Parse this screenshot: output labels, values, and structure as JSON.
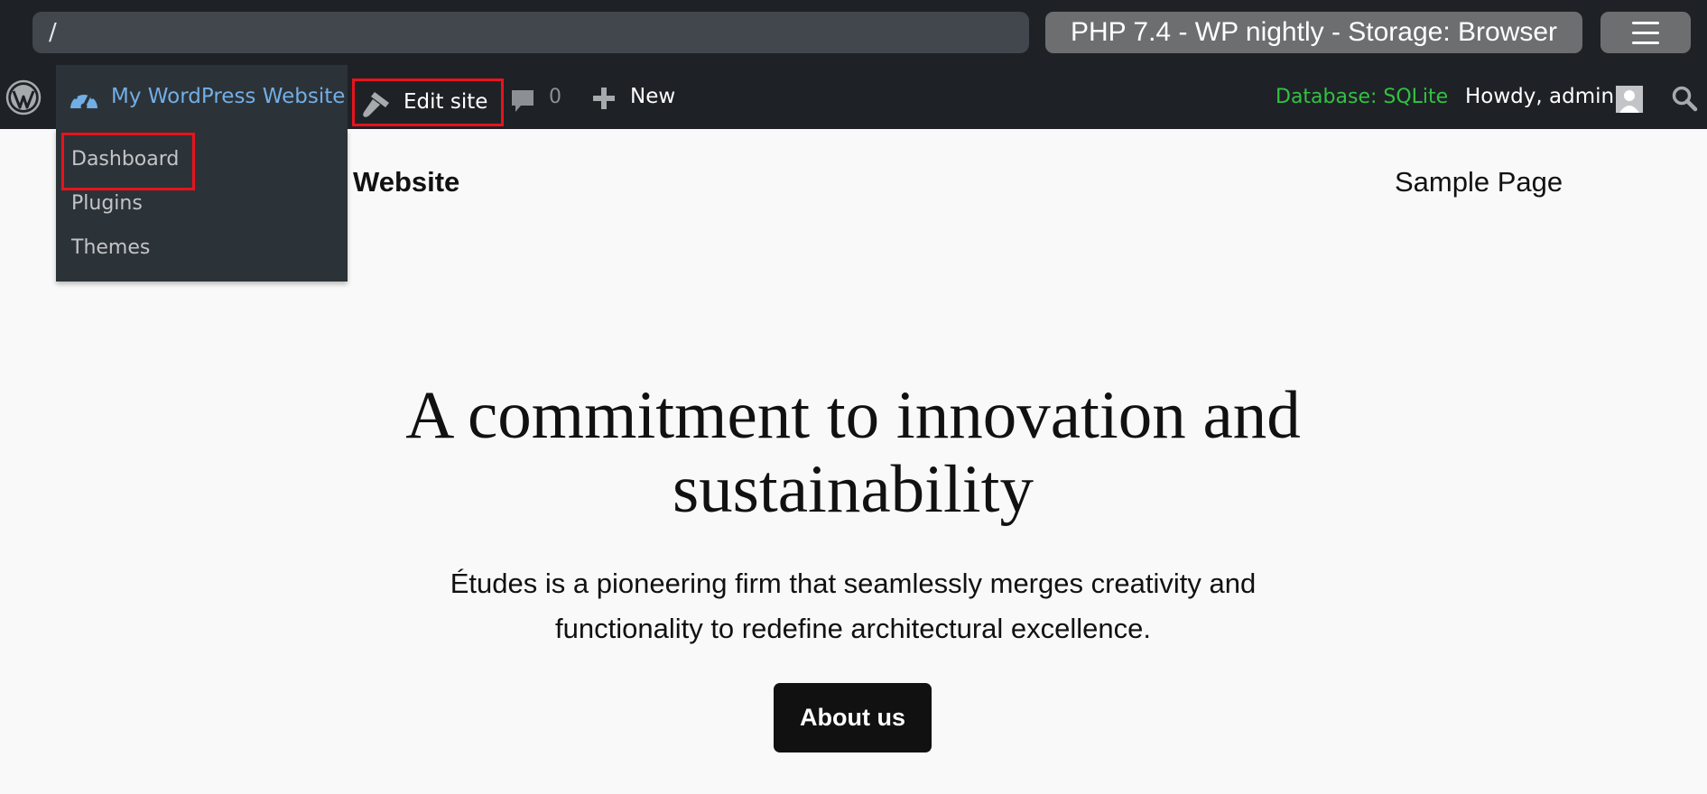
{
  "browser": {
    "url": "/",
    "environment_label": "PHP 7.4 - WP nightly - Storage: Browser",
    "menu_icon": "hamburger-menu-icon"
  },
  "admin_bar": {
    "wp_logo_icon": "wordpress-logo-icon",
    "site_icon": "dashboard-gauge-icon",
    "site_name": "My WordPress Website",
    "edit_site_icon": "paintbrush-icon",
    "edit_site_label": "Edit site",
    "comments_icon": "comment-bubble-icon",
    "comment_count": "0",
    "new_icon": "plus-icon",
    "new_label": "New",
    "database_label": "Database: SQLite",
    "howdy_label": "Howdy, admin",
    "search_icon": "search-icon"
  },
  "site_dropdown": {
    "items": [
      {
        "label": "Dashboard"
      },
      {
        "label": "Plugins"
      },
      {
        "label": "Themes"
      }
    ]
  },
  "site_header": {
    "title_visible_part": "Website",
    "nav_item": "Sample Page"
  },
  "hero": {
    "heading_line1": "A commitment to innovation and",
    "heading_line2": "sustainability",
    "text_line1": "Études is a pioneering firm that seamlessly merges creativity and",
    "text_line2": "functionality to redefine architectural excellence.",
    "button_label": "About us"
  },
  "colors": {
    "bar_background": "#1e2227",
    "highlight_border": "#e8131c",
    "site_name_blue": "#72aee6",
    "database_green": "#32c241",
    "page_background": "#f9f9f9"
  }
}
